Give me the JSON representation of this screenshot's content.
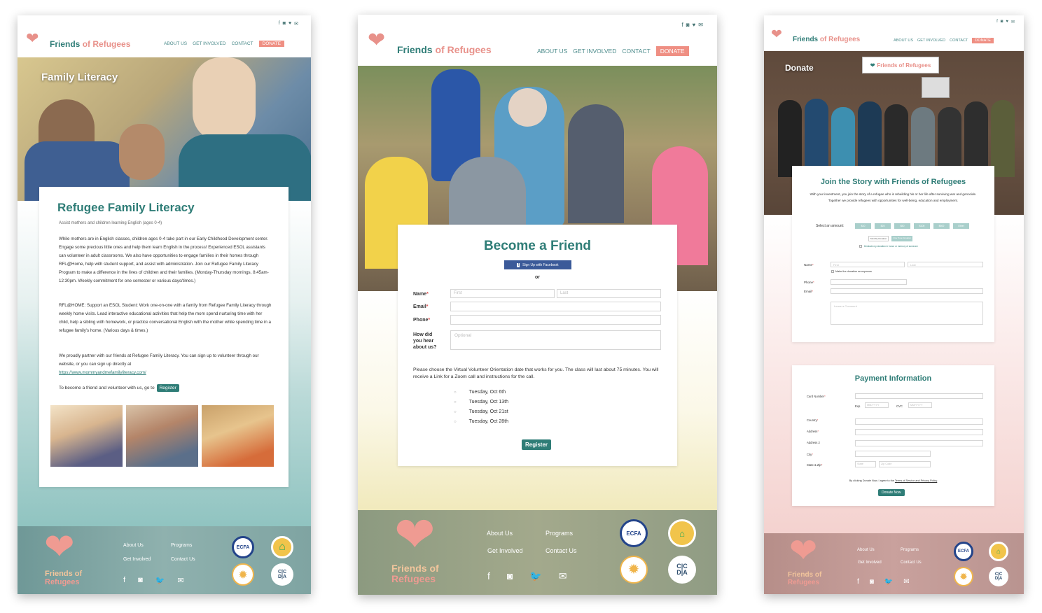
{
  "brand": {
    "name_part1": "Friends",
    "name_part2": "of",
    "name_part3": "Refugees"
  },
  "nav": {
    "about": "ABOUT US",
    "involved": "GET INVOLVED",
    "contact": "CONTACT",
    "donate": "DONATE"
  },
  "social_icons": [
    "facebook-icon",
    "instagram-icon",
    "twitter-icon",
    "mail-icon"
  ],
  "footer": {
    "about": "About Us",
    "programs": "Programs",
    "involved": "Get Involved",
    "contact": "Contact Us",
    "brand_line1": "Friends of",
    "brand_line2": "Refugees",
    "badges": {
      "ecfa": "ECFA",
      "cdca_top": "C|C",
      "cdca_bottom": "D|A"
    }
  },
  "literacy": {
    "hero_title": "Family Literacy",
    "title": "Refugee Family Literacy",
    "subtitle": "Assist mothers and children learning English (ages 0-4)",
    "para1": "While mothers are in English classes, children ages 0-4 take part in our Early Childhood Development center. Engage some precious little ones and help them learn English in the process! Experienced ESOL assistants can volunteer in adult classrooms. We also have opportunities to engage families in their homes through RFL@Home, help with student support, and assist with administration. Join our Refugee Family Literacy Program to make a difference in the lives of children and their families. (Monday-Thursday mornings, 8:45am-12:30pm. Weekly commitment for one semester or various days/times.)",
    "para2": "RFL@HOME: Support an ESOL Student: Work one-on-one with a family from Refugee Family Literacy through weekly home visits. Lead interactive educational activities that help the mom spend nurturing time with her child, help a sibling with homework, or practice conversational English with the mother while spending time in a refugee family's home. (Various days & times.)",
    "para3": "We proudly partner with our friends at Refugee Family Literacy. You can sign up to volunteer through our website, or you can sign up directly at",
    "link": "https://www.mommyandmefamilyliteracy.com/",
    "cta": "To become a friend and volunteer with us, go to",
    "register": "Register"
  },
  "friend": {
    "title": "Become a Friend",
    "facebook": "Sign Up with Facebook",
    "or": "or",
    "name_label": "Name",
    "email_label": "Email",
    "phone_label": "Phone",
    "hear_label_1": "How did",
    "hear_label_2": "you hear",
    "hear_label_3": "about us?",
    "first_ph": "First",
    "last_ph": "Last",
    "optional_ph": "Optional",
    "instructions": "Please choose the Virtual Volunteer Orientation date that works for you. The class will last about 75 minutes. You will receive a Link for a Zoom call and instructions for the call.",
    "dates": [
      "Tuesday, Oct 6th",
      "Tuesday, Oct 13th",
      "Tuesday, Oct 21st",
      "Tuesday, Oct 28th"
    ],
    "register": "Register"
  },
  "donate": {
    "hero_title": "Donate",
    "sign": "Friends of Refugees",
    "title": "Join the Story with Friends of Refugees",
    "intro": "With your investment, you join the story of a refugee who is rebuilding his or her life after surviving war and genocide. Together we provide refugees with opportunities for well-being, education and employment.",
    "select_amount": "Select an amount:",
    "amounts": [
      "$10",
      "$25",
      "$50",
      "$100",
      "$500",
      "Other"
    ],
    "monthly": "Monthly Donation",
    "one_time": "One Time Donation",
    "dedicate": "Dedicate my donation in honor or memory of someone",
    "name_label": "Name",
    "phone_label": "Phone",
    "email_label": "Email",
    "first_ph": "First",
    "last_ph": "Last",
    "anon": "Make the donation anonymous",
    "comment_ph": "Leave a Comment",
    "payment_title": "Payment Information",
    "card_label": "Card Number",
    "exp_label": "Exp.",
    "cvc_label": "CVC",
    "exp_ph": "MM/YYYY",
    "cvc_ph": "MM/YYYY",
    "country_label": "Country",
    "address_label": "Address",
    "address2_label": "Address 2",
    "city_label": "City",
    "statezip_label": "State & Zip",
    "state_ph": "State",
    "zip_ph": "Zip Code",
    "terms_pre": "By clicking Donate Now, I agree to the",
    "terms_link": "Terms of Service and Privacy Policy",
    "donate_now": "Donate Now"
  },
  "colors": {
    "teal": "#2f7d77",
    "coral": "#ef8f83",
    "heart": "#e8918a"
  }
}
